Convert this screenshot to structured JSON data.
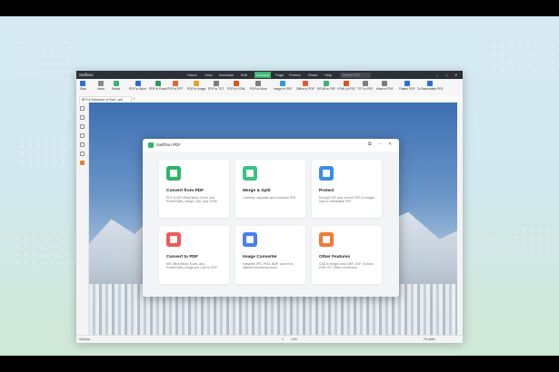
{
  "app": {
    "title": "SwifDoo",
    "menu": [
      "Home",
      "View",
      "Annotate",
      "Edit",
      "Convert",
      "Page",
      "Protect",
      "Share",
      "Help"
    ],
    "active_menu": "Convert",
    "search_placeholder": "Search PDF",
    "window_controls": [
      "–",
      "□",
      "✕"
    ]
  },
  "toolbar": [
    {
      "label": "Start",
      "icon": "start-icon",
      "color": "#2e6fd6"
    },
    {
      "label": "Hand",
      "icon": "hand-icon",
      "color": "#8a8a8a"
    },
    {
      "label": "Select",
      "icon": "cursor-icon",
      "color": "#3cb371"
    },
    {
      "label": "PDF to Word",
      "icon": "word-icon",
      "color": "#2b6bd0"
    },
    {
      "label": "PDF to Excel",
      "icon": "excel-icon",
      "color": "#2f9a55"
    },
    {
      "label": "PDF to PPT",
      "icon": "ppt-icon",
      "color": "#e0662d"
    },
    {
      "label": "PDF to Image",
      "icon": "image-icon",
      "color": "#e3a32a"
    },
    {
      "label": "PDF to TXT",
      "icon": "txt-icon",
      "color": "#7d7d7d"
    },
    {
      "label": "PDF to HTML",
      "icon": "html-icon",
      "color": "#d9541e"
    },
    {
      "label": "PDF to More",
      "icon": "more-icon",
      "color": "#7d7d7d"
    },
    {
      "label": "Image to PDF",
      "icon": "image-pdf-icon",
      "color": "#2f9cd6"
    },
    {
      "label": "Office to PDF",
      "icon": "office-pdf-icon",
      "color": "#e25b32"
    },
    {
      "label": "EPUB to PDF",
      "icon": "epub-icon",
      "color": "#3cb371"
    },
    {
      "label": "HTML to PDF",
      "icon": "html-pdf-icon",
      "color": "#d9541e"
    },
    {
      "label": "TXT to PDF",
      "icon": "txt-pdf-icon",
      "color": "#7d7d7d"
    },
    {
      "label": "More to PDF",
      "icon": "more-pdf-icon",
      "color": "#7d7d7d"
    },
    {
      "label": "Flatten PDF",
      "icon": "flatten-icon",
      "color": "#2e6fd6"
    },
    {
      "label": "To Searchable PDF",
      "icon": "searchable-icon",
      "color": "#2e6fd6"
    }
  ],
  "tab": {
    "label": "BF3 A Selection of Poet...pdf",
    "close": "×",
    "add": "+"
  },
  "dialog": {
    "title": "SwifDoo PDF",
    "cards": [
      {
        "title": "Convert from PDF",
        "desc": "PDF to MS Office(Word, Excel, and PowerPoint), image, CAD, and HTML",
        "color": "#2fb36b",
        "icon": "convert-from-pdf-icon"
      },
      {
        "title": "Merge & Split",
        "desc": "Combine, separate and compress PDF",
        "color": "#3cc184",
        "icon": "merge-split-icon"
      },
      {
        "title": "Protect",
        "desc": "Encrypt PDF and convert PDF to images only or searchable PDF",
        "color": "#3a8ee6",
        "icon": "protect-icon"
      },
      {
        "title": "Convert to PDF",
        "desc": "MS Office(Word, Excel, and PowerPoint), image and CAD to PDF",
        "color": "#ef5a5a",
        "icon": "convert-to-pdf-icon"
      },
      {
        "title": "Image Converter",
        "desc": "Integrate JPG, PNG, BMP, convert to different format and more",
        "color": "#4a7ff0",
        "icon": "image-converter-icon"
      },
      {
        "title": "Other Features",
        "desc": "CAD to images and DWF, DXF, to Word, DWF, IFC Office conversion",
        "color": "#f07a3a",
        "icon": "other-features-icon"
      }
    ]
  },
  "status": {
    "sidebar": "Sidebar",
    "page": "1",
    "page_total": "/100",
    "zoom": "Fit width"
  }
}
